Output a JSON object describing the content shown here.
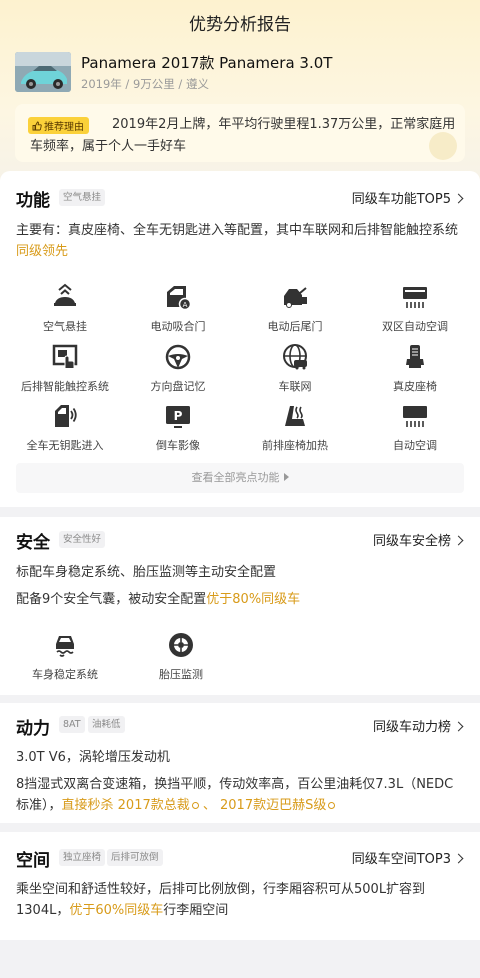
{
  "page": {
    "title": "优势分析报告"
  },
  "car": {
    "name": "Panamera 2017款 Panamera 3.0T",
    "meta": "2019年 / 9万公里 / 遵义",
    "thumb_icon": "car-photo"
  },
  "reason": {
    "badge": "推荐理由",
    "text": "2019年2月上牌，年平均行驶里程1.37万公里，正常家庭用车频率，属于个人一手好车"
  },
  "features": {
    "title": "功能",
    "tag": "空气悬挂",
    "rank": "同级车功能TOP5",
    "desc_main": "主要有：真皮座椅、全车无钥匙进入等配置，其中车联网和后排智能触控系统",
    "desc_hl": "同级领先",
    "items": [
      {
        "label": "空气悬挂",
        "icon": "air-suspension-icon"
      },
      {
        "label": "电动吸合门",
        "icon": "soft-close-door-icon"
      },
      {
        "label": "电动后尾门",
        "icon": "power-tailgate-icon"
      },
      {
        "label": "双区自动空调",
        "icon": "dual-zone-ac-icon"
      },
      {
        "label": "后排智能触控系统",
        "icon": "rear-touch-control-icon"
      },
      {
        "label": "方向盘记忆",
        "icon": "steering-memory-icon"
      },
      {
        "label": "车联网",
        "icon": "connected-car-icon"
      },
      {
        "label": "真皮座椅",
        "icon": "leather-seat-icon"
      },
      {
        "label": "全车无钥匙进入",
        "icon": "keyless-entry-icon"
      },
      {
        "label": "倒车影像",
        "icon": "reverse-camera-icon"
      },
      {
        "label": "前排座椅加热",
        "icon": "seat-heating-icon"
      },
      {
        "label": "自动空调",
        "icon": "auto-ac-icon"
      }
    ],
    "view_all": "查看全部亮点功能"
  },
  "safety": {
    "title": "安全",
    "tag": "安全性好",
    "rank": "同级车安全榜",
    "line1": "标配车身稳定系统、胎压监测等主动安全配置",
    "line2_main": "配备9个安全气囊，被动安全配置",
    "line2_hl": "优于80%同级车",
    "items": [
      {
        "label": "车身稳定系统",
        "icon": "stability-control-icon"
      },
      {
        "label": "胎压监测",
        "icon": "tire-pressure-icon"
      }
    ]
  },
  "power": {
    "title": "动力",
    "tags": [
      "8AT",
      "油耗低"
    ],
    "rank": "同级车动力榜",
    "line1": "3.0T V6，涡轮增压发动机",
    "line2_main": "8挡湿式双离合变速箱，换挡平顺，传动效率高，百公里油耗仅7.3L（NEDC标准），",
    "line2_hl1": "直接秒杀 2017款总裁",
    "line2_sep": " 、 ",
    "line2_hl2": "2017款迈巴赫S级"
  },
  "space": {
    "title": "空间",
    "tags": [
      "独立座椅",
      "后排可放倒"
    ],
    "rank": "同级车空间TOP3",
    "line_main": "乘坐空间和舒适性较好，后排可比例放倒，行李厢容积可从500L扩容到1304L，",
    "line_hl": "优于60%同级车",
    "line_tail": "行李厢空间"
  },
  "colors": {
    "accent_yellow": "#fbd13a",
    "highlight": "#d89b1a"
  }
}
